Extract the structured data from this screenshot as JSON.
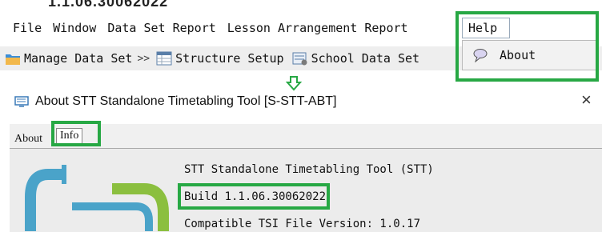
{
  "top_fragment": "1.1.06.30062022",
  "menubar": [
    "File",
    "Window",
    "Data Set Report",
    "Lesson Arrangement Report"
  ],
  "help_menu": {
    "label": "Help",
    "item": "About"
  },
  "toolbar": [
    {
      "icon": "folder-icon",
      "label": "Manage Data Set",
      "trail": ">>"
    },
    {
      "icon": "table-icon",
      "label": "Structure Setup",
      "trail": ""
    },
    {
      "icon": "school-data-icon",
      "label": "School Data Set",
      "trail": ""
    }
  ],
  "dialog": {
    "title": "About STT Standalone Timetabling Tool [S-STT-ABT]",
    "tabs": [
      "About",
      "Info"
    ],
    "active_tab": "Info",
    "lines": [
      "STT Standalone Timetabling Tool (STT)",
      "Build 1.1.06.30062022",
      "Compatible TSI File Version: 1.0.17"
    ]
  },
  "colors": {
    "highlight": "#27a844",
    "arrow": "#27a844",
    "logo_blue": "#4aa3c9",
    "logo_green": "#8bbf3f"
  }
}
